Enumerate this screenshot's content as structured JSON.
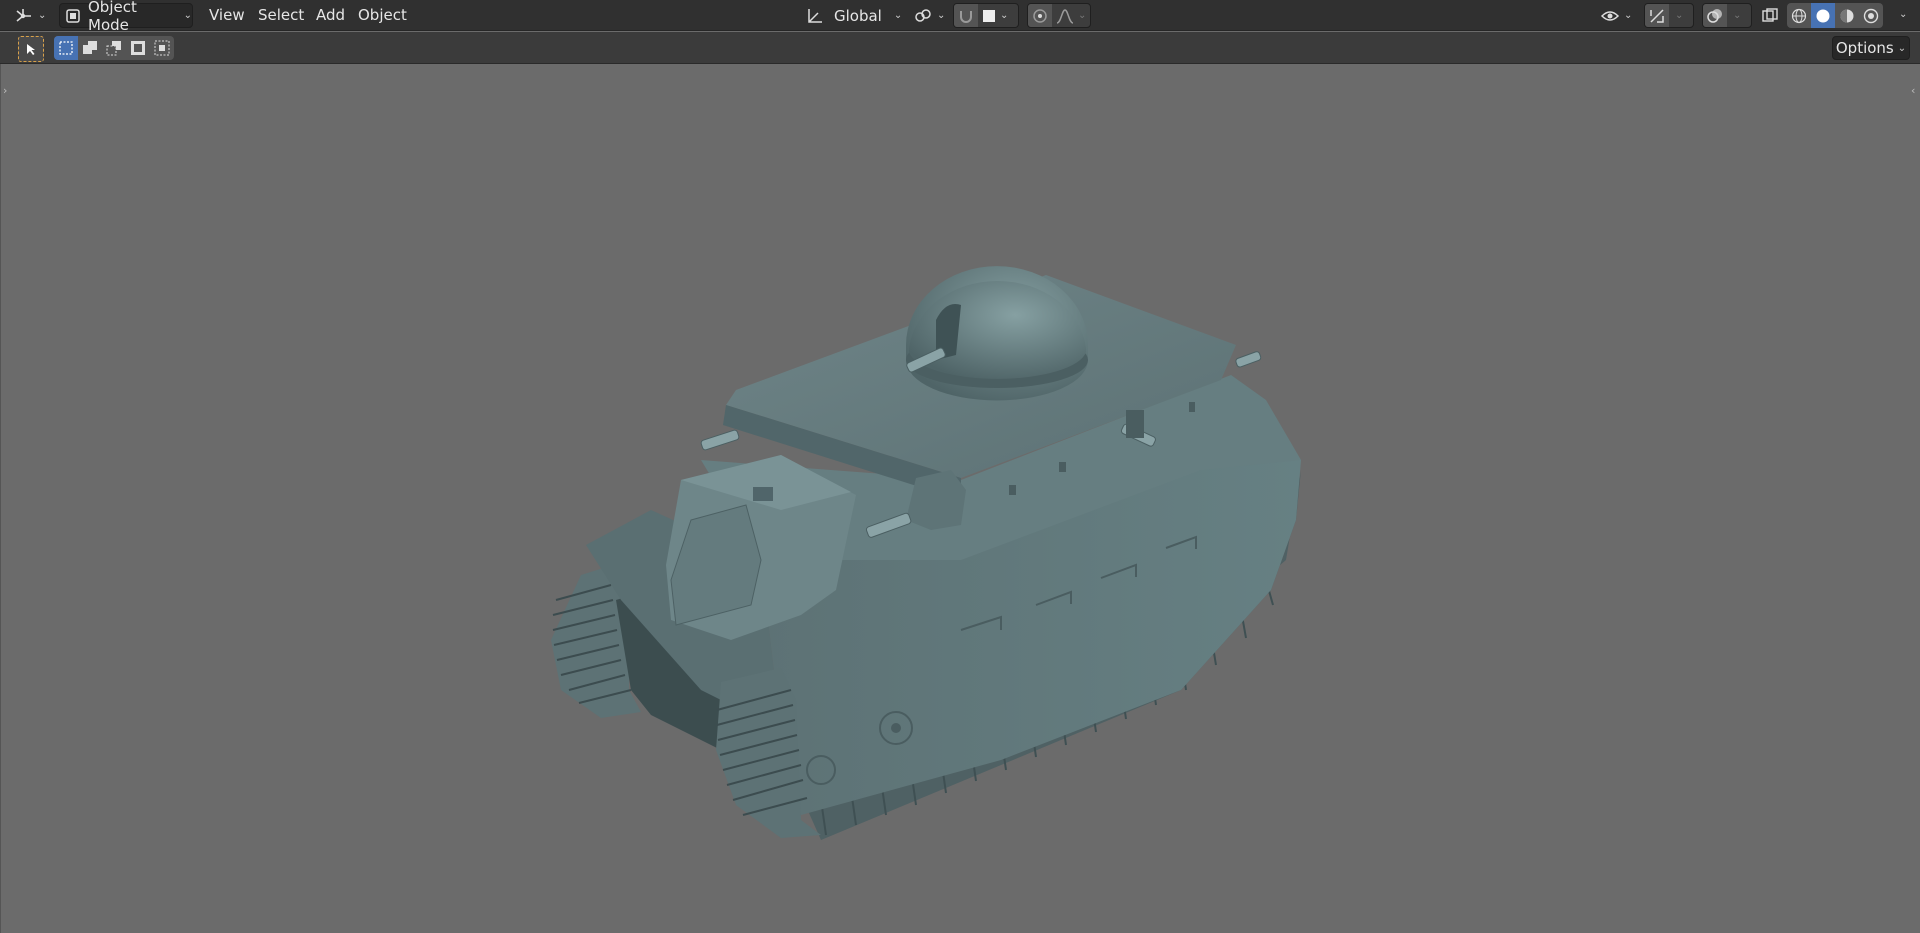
{
  "header": {
    "editor_type_icon": "view3d-editor-icon",
    "mode": {
      "icon": "object-mode-icon",
      "label": "Object Mode"
    },
    "menus": [
      "View",
      "Select",
      "Add",
      "Object"
    ],
    "transform_orientation": {
      "icon": "orientation-axes-icon",
      "label": "Global"
    },
    "pivot_icon": "pivot-point-icon",
    "snap_icon": "snap-magnet-icon",
    "snap_target_icon": "snap-increment-icon",
    "proportional_icon": "proportional-edit-icon",
    "falloff_icon": "falloff-curve-icon",
    "visibility_icon": "visibility-eye-icon",
    "gizmo_icon": "gizmo-icon",
    "overlay_icon": "overlay-icon",
    "xray_icon": "xray-icon",
    "shading_modes": [
      {
        "name": "wireframe-shading-icon",
        "active": false
      },
      {
        "name": "solid-shading-icon",
        "active": true
      },
      {
        "name": "material-shading-icon",
        "active": false
      },
      {
        "name": "rendered-shading-icon",
        "active": false
      }
    ]
  },
  "toolbar": {
    "select_tool_icon": "select-cursor-icon",
    "select_modes": [
      "set-new-selection-icon",
      "extend-selection-icon",
      "subtract-selection-icon",
      "invert-selection-icon",
      "intersect-selection-icon"
    ],
    "options_label": "Options"
  },
  "viewport": {
    "object": "tank-model",
    "colors": {
      "background": "#6b6b6b",
      "mesh": "#62777a",
      "header": "#303030",
      "accent": "#4772b3"
    }
  }
}
